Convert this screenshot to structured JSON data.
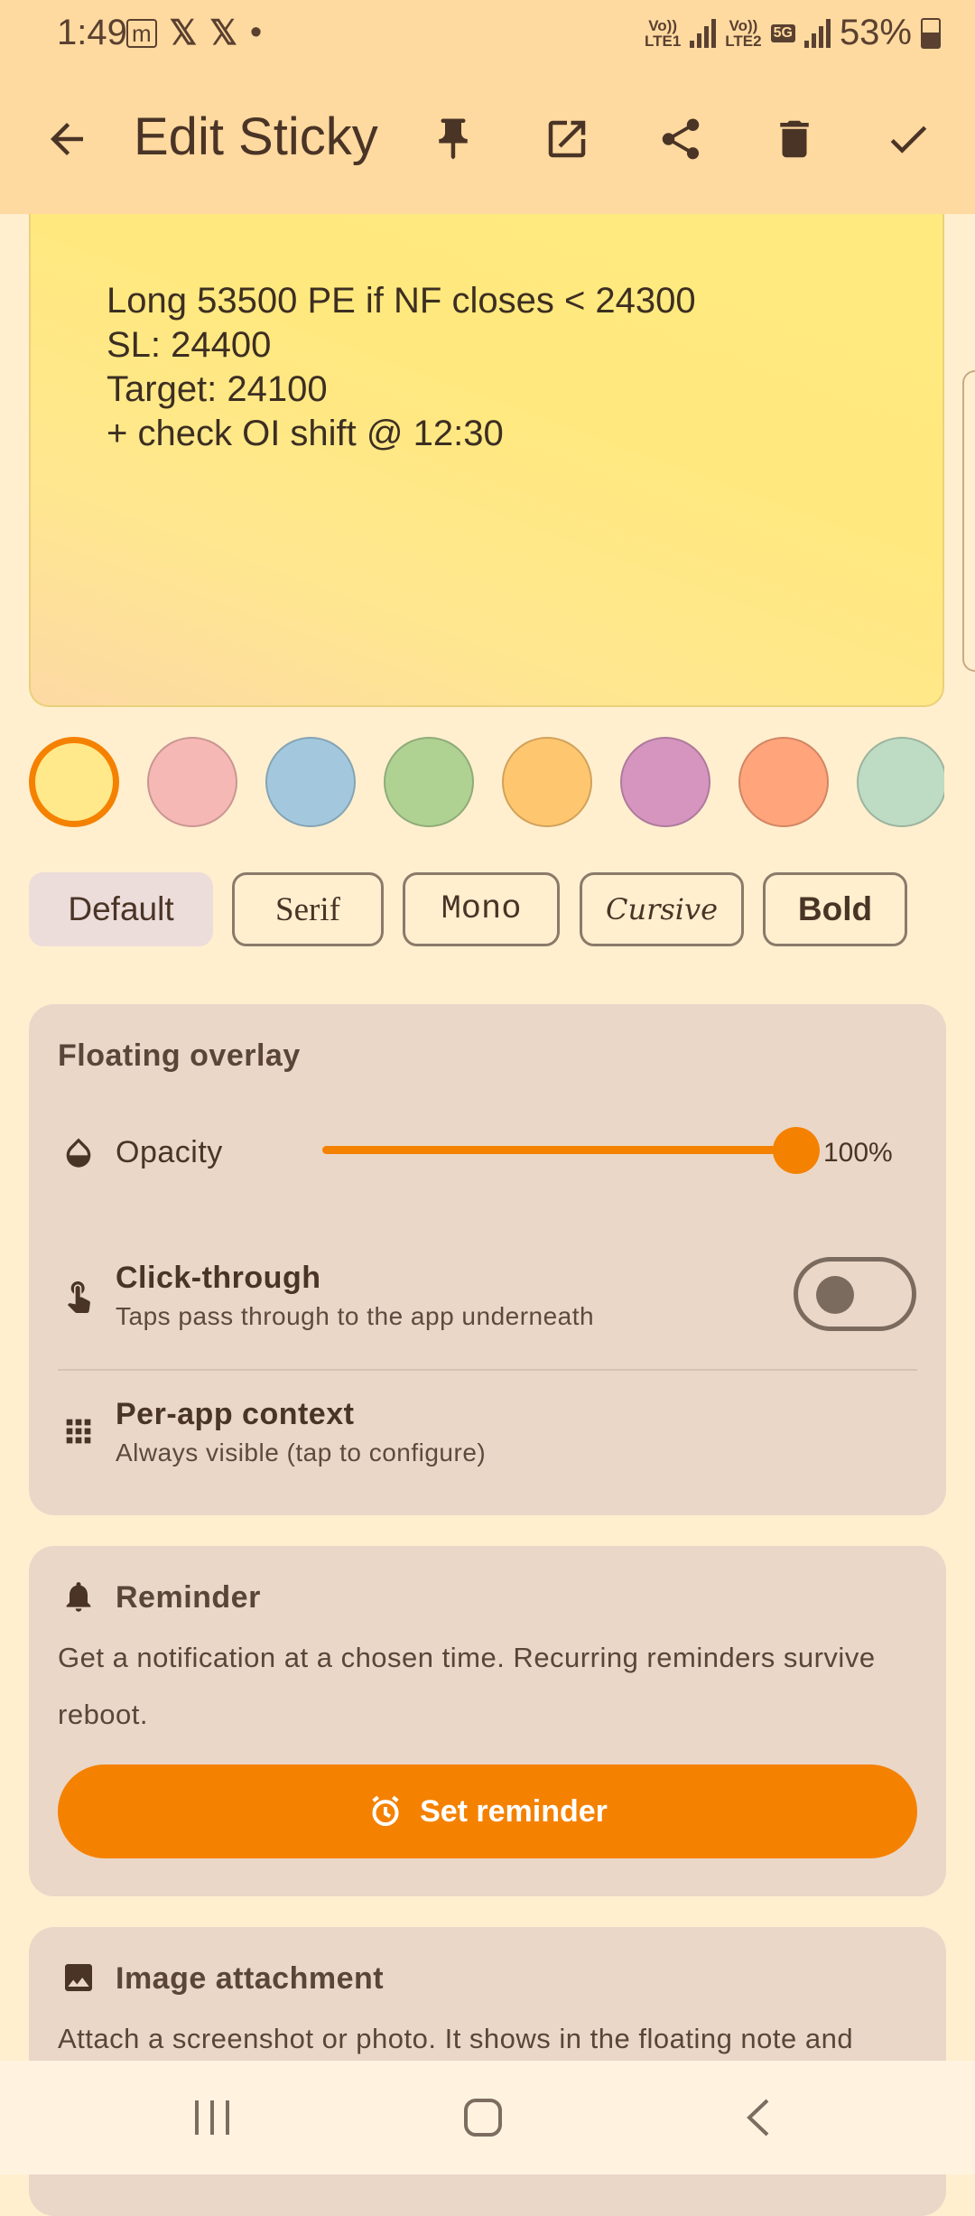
{
  "status_bar": {
    "time": "1:49",
    "notification_icons": [
      "m",
      "𝕏",
      "𝕏",
      "•"
    ],
    "sim1_label_top": "Vo))",
    "sim1_label_bottom": "LTE1",
    "sim2_label_top": "Vo))",
    "sim2_label_bottom": "LTE2",
    "network_badge": "5G",
    "battery": "53%"
  },
  "app_bar": {
    "title": "Edit Sticky",
    "icons": [
      "back-arrow-icon",
      "pin-icon",
      "open-external-icon",
      "share-icon",
      "delete-icon",
      "check-icon"
    ]
  },
  "note": {
    "text": "Long 53500 PE if NF closes < 24300\nSL: 24400\nTarget: 24100\n+ check OI shift @ 12:30"
  },
  "colors": {
    "swatches": [
      "#FFE98A",
      "#F6B8B4",
      "#A3C8DD",
      "#AFD293",
      "#FFC670",
      "#D595BF",
      "#FFA47B",
      "#BEDCC3"
    ],
    "selected_index": 0,
    "accent": "#F58100"
  },
  "fonts": {
    "options": [
      "Default",
      "Serif",
      "Mono",
      "Cursive",
      "Bold"
    ],
    "selected": "Default"
  },
  "overlay": {
    "title": "Floating overlay",
    "opacity_label": "Opacity",
    "opacity_value": "100%",
    "opacity_fraction": 1.0,
    "click_through_title": "Click-through",
    "click_through_sub": "Taps pass through to the app underneath",
    "click_through_on": false,
    "per_app_title": "Per-app context",
    "per_app_sub": "Always visible (tap to configure)"
  },
  "reminder": {
    "title": "Reminder",
    "description": "Get a notification at a chosen time. Recurring reminders survive reboot.",
    "button_label": "Set reminder"
  },
  "image_attachment": {
    "title": "Image attachment",
    "description": "Attach a screenshot or photo. It shows in the floating note and"
  }
}
